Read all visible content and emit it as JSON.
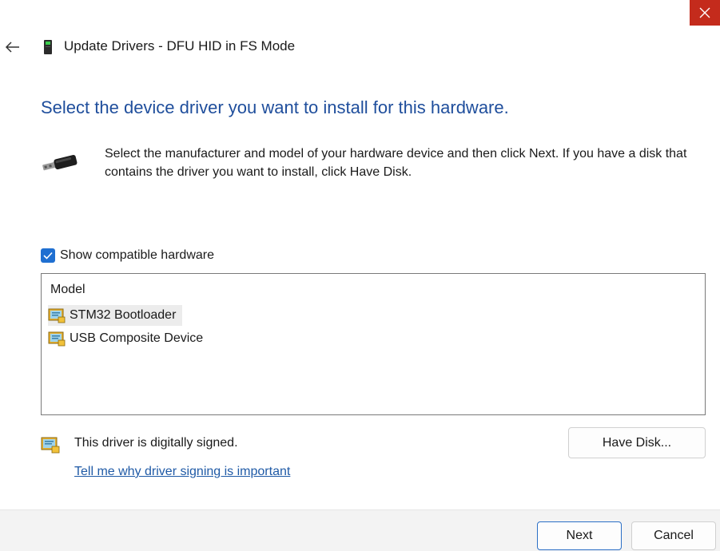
{
  "window": {
    "title": "Update Drivers - DFU HID in FS Mode",
    "close_icon": "close-icon",
    "back_icon": "back-arrow-icon",
    "device_icon": "device-icon"
  },
  "content": {
    "heading": "Select the device driver you want to install for this hardware.",
    "instructions": "Select the manufacturer and model of your hardware device and then click Next. If you have a disk that contains the driver you want to install, click Have Disk.",
    "instructions_icon": "usb-plug-icon"
  },
  "compatible": {
    "label": "Show compatible hardware",
    "checked": true
  },
  "model_list": {
    "header": "Model",
    "items": [
      {
        "label": "STM32 Bootloader",
        "icon": "signed-driver-icon",
        "selected": true
      },
      {
        "label": "USB Composite Device",
        "icon": "signed-driver-icon",
        "selected": false
      }
    ]
  },
  "signing": {
    "status_text": "This driver is digitally signed.",
    "link_text": "Tell me why driver signing is important",
    "icon": "signed-driver-icon"
  },
  "buttons": {
    "have_disk": "Have Disk...",
    "next": "Next",
    "cancel": "Cancel"
  },
  "colors": {
    "heading": "#1f4e9c",
    "close_button": "#c42b1c",
    "checkbox": "#1f6fd1",
    "link": "#1f5aa6",
    "selection": "#ececec"
  }
}
